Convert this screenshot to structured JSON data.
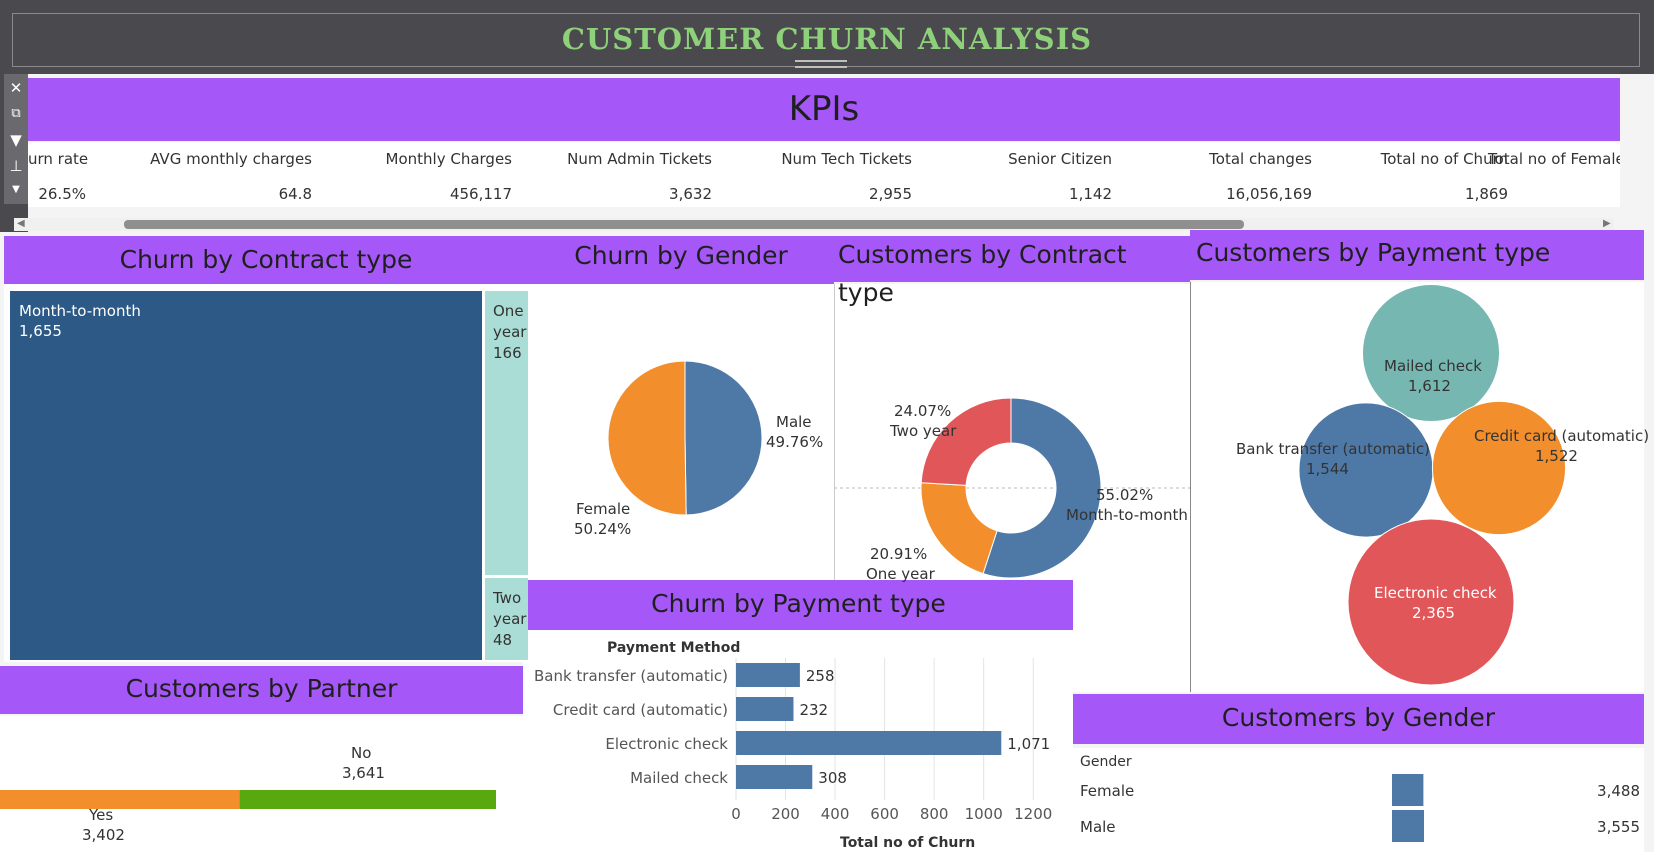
{
  "header": {
    "title": "CUSTOMER CHURN ANALYSIS"
  },
  "toolbar": {
    "icons": [
      "close-icon",
      "popout-icon",
      "filter-icon",
      "pin-icon",
      "dropdown-icon"
    ]
  },
  "kpis": {
    "banner": "KPIs",
    "columns": [
      {
        "header": "urn rate",
        "value": "26.5%"
      },
      {
        "header": "AVG monthly charges",
        "value": "64.8"
      },
      {
        "header": "Monthly Charges",
        "value": "456,117"
      },
      {
        "header": "Num Admin Tickets",
        "value": "3,632"
      },
      {
        "header": "Num Tech Tickets",
        "value": "2,955"
      },
      {
        "header": "Senior Citizen",
        "value": "1,142"
      },
      {
        "header": "Total changes",
        "value": "16,056,169"
      },
      {
        "header": "Total no of Churn",
        "value": "1,869"
      },
      {
        "header": "Total no of Female",
        "value": ""
      }
    ]
  },
  "colors": {
    "accent": "#a557f7",
    "title": "#8fd17a",
    "blue": "#4e79a7",
    "dark_blue": "#2c5985",
    "orange": "#f28e2b",
    "red": "#e15759",
    "teal": "#76b7b2",
    "light_teal": "#aaddd6",
    "green": "#59a80f"
  },
  "chart_data": [
    {
      "type": "treemap",
      "title": "Churn by Contract type",
      "items": [
        {
          "label": "Month-to-month",
          "value": 1655,
          "display": "1,655"
        },
        {
          "label": "One year",
          "value": 166,
          "display": "166",
          "lines": [
            "One",
            "year"
          ]
        },
        {
          "label": "Two year",
          "value": 48,
          "display": "48",
          "lines": [
            "Two",
            "year"
          ]
        }
      ]
    },
    {
      "type": "pie",
      "title": "Churn by Gender",
      "slices": [
        {
          "label": "Male",
          "percent": 49.76,
          "display": "49.76%",
          "color": "#4e79a7"
        },
        {
          "label": "Female",
          "percent": 50.24,
          "display": "50.24%",
          "color": "#f28e2b"
        }
      ]
    },
    {
      "type": "pie",
      "donut": true,
      "title": "Customers by Contract type",
      "slices": [
        {
          "label": "Month-to-month",
          "percent": 55.02,
          "display": "55.02%",
          "color": "#4e79a7"
        },
        {
          "label": "One year",
          "percent": 20.91,
          "display": "20.91%",
          "color": "#f28e2b"
        },
        {
          "label": "Two year",
          "percent": 24.07,
          "display": "24.07%",
          "color": "#e15759"
        }
      ]
    },
    {
      "type": "bubble",
      "title": "Customers by Payment type",
      "items": [
        {
          "label": "Mailed check",
          "value": 1612,
          "display": "1,612",
          "color": "#76b7b2"
        },
        {
          "label": "Bank transfer (automatic)",
          "value": 1544,
          "display": "1,544",
          "color": "#4e79a7"
        },
        {
          "label": "Credit card (automatic)",
          "value": 1522,
          "display": "1,522",
          "color": "#f28e2b"
        },
        {
          "label": "Electronic check",
          "value": 2365,
          "display": "2,365",
          "color": "#e15759"
        }
      ]
    },
    {
      "type": "bar",
      "orientation": "horizontal",
      "title": "Churn by Payment type",
      "row_header": "Payment Method",
      "xlabel": "Total no of Churn",
      "xlim": [
        0,
        1300
      ],
      "xticks": [
        0,
        200,
        400,
        600,
        800,
        1000,
        1200
      ],
      "categories": [
        "Bank transfer (automatic)",
        "Credit card (automatic)",
        "Electronic check",
        "Mailed check"
      ],
      "values": [
        258,
        232,
        1071,
        308
      ],
      "displays": [
        "258",
        "232",
        "1,071",
        "308"
      ],
      "grid": true
    },
    {
      "type": "bar",
      "orientation": "stacked-horizontal",
      "title": "Customers by Partner",
      "items": [
        {
          "label": "Yes",
          "value": 3402,
          "display": "3,402",
          "color": "#f28e2b"
        },
        {
          "label": "No",
          "value": 3641,
          "display": "3,641",
          "color": "#59a80f"
        }
      ]
    },
    {
      "type": "bar",
      "orientation": "horizontal",
      "title": "Customers by Gender",
      "row_header": "Gender",
      "categories": [
        "Female",
        "Male"
      ],
      "values": [
        3488,
        3555
      ],
      "displays": [
        "3,488",
        "3,555"
      ]
    }
  ]
}
